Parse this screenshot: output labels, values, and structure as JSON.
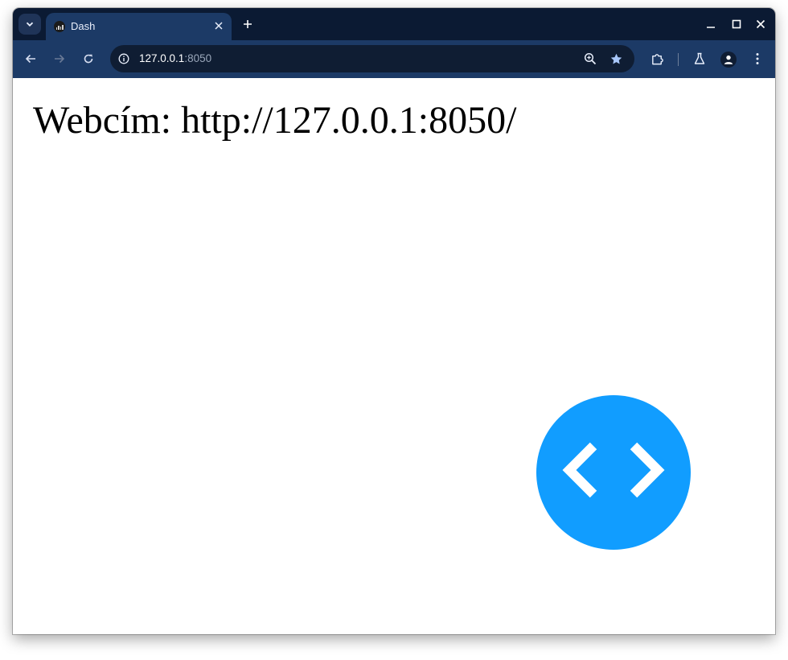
{
  "tab": {
    "title": "Dash",
    "favicon": "dash-favicon-icon"
  },
  "address_bar": {
    "host": "127.0.0.1",
    "port": ":8050"
  },
  "page": {
    "heading": "Webcím: http://127.0.0.1:8050/"
  },
  "icons": {
    "tab_search": "chevron-down-icon",
    "tab_close": "close-icon",
    "new_tab": "plus-icon",
    "minimize": "minimize-icon",
    "maximize": "maximize-icon",
    "close_window": "close-icon",
    "back": "arrow-left-icon",
    "forward": "arrow-right-icon",
    "reload": "reload-icon",
    "site_info": "info-icon",
    "zoom": "zoom-icon",
    "bookmark": "star-icon",
    "extensions": "puzzle-icon",
    "labs": "flask-icon",
    "profile": "avatar-icon",
    "menu": "kebab-menu-icon",
    "devtools": "code-brackets-icon"
  },
  "colors": {
    "tabstrip_bg": "#0b1a33",
    "toolbar_bg": "#1c3a66",
    "omnibox_bg": "#0f1d33",
    "dash_devtools_blue": "#119dff"
  }
}
